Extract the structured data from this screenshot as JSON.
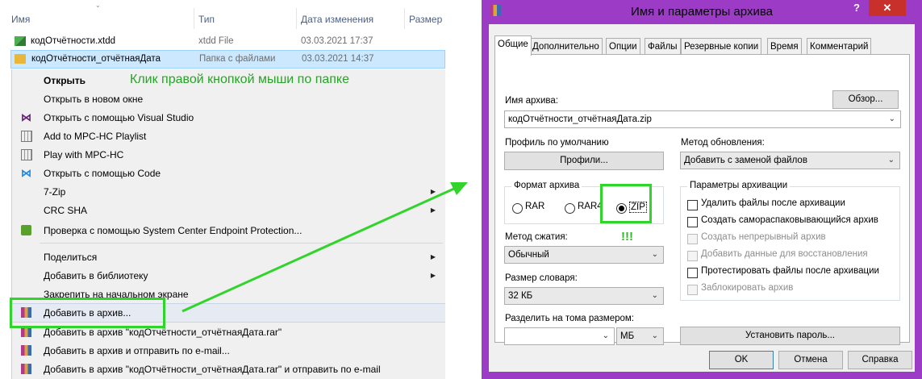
{
  "explorer": {
    "columns": {
      "name": "Имя",
      "type": "Тип",
      "date": "Дата изменения",
      "size": "Размер"
    },
    "files": [
      {
        "name": "кодОтчётности.xtdd",
        "type": "xtdd File",
        "date": "03.03.2021 17:37"
      },
      {
        "name": "кодОтчётности_отчётнаяДата",
        "type": "Папка с файлами",
        "date": "03.03.2021 14:37"
      }
    ]
  },
  "context_menu": {
    "items": [
      {
        "label": "Открыть",
        "icon": "none"
      },
      {
        "label": "Открыть в новом окне",
        "icon": "none"
      },
      {
        "label": "Открыть с помощью Visual Studio",
        "icon": "visual-studio-icon"
      },
      {
        "label": "Add to MPC-HC Playlist",
        "icon": "mpc-hc-icon"
      },
      {
        "label": "Play with MPC-HC",
        "icon": "mpc-hc-icon"
      },
      {
        "label": "Открыть с помощью Code",
        "icon": "vscode-icon"
      },
      {
        "label": "7-Zip",
        "icon": "none",
        "submenu": true
      },
      {
        "label": "CRC SHA",
        "icon": "none",
        "submenu": true
      },
      {
        "label": "Проверка с помощью System Center Endpoint Protection...",
        "icon": "endpoint-protection-icon"
      },
      {
        "label": "Поделиться",
        "icon": "none",
        "submenu": true
      },
      {
        "label": "Добавить в библиотеку",
        "icon": "none",
        "submenu": true
      },
      {
        "label": "Закрепить на начальном экране",
        "icon": "none"
      },
      {
        "label": "Добавить в архив...",
        "icon": "winrar-icon"
      },
      {
        "label": "Добавить в архив \"кодОтчётности_отчётнаяДата.rar\"",
        "icon": "winrar-icon"
      },
      {
        "label": "Добавить в архив и отправить по e-mail...",
        "icon": "winrar-icon"
      },
      {
        "label": "Добавить в архив \"кодОтчётности_отчётнаяДата.rar\" и отправить по e-mail",
        "icon": "winrar-icon"
      }
    ],
    "annotation": "Клик правой кнопкой мыши по папке"
  },
  "dialog": {
    "title": "Имя и параметры архива",
    "help_button": "?",
    "close_button": "✕",
    "tabs": [
      "Общие",
      "Дополнительно",
      "Опции",
      "Файлы",
      "Резервные копии",
      "Время",
      "Комментарий"
    ],
    "archive_name_label": "Имя архива:",
    "browse_button": "Обзор...",
    "archive_name_value": "кодОтчётности_отчётнаяДата.zip",
    "default_profile_label": "Профиль по умолчанию",
    "profiles_button": "Профили...",
    "update_method_label": "Метод обновления:",
    "update_method_value": "Добавить с заменой файлов",
    "format_group_label": "Формат архива",
    "format_options": [
      "RAR",
      "RAR4",
      "ZIP"
    ],
    "format_selected": "ZIP",
    "exclamation": "!!!",
    "compression_label": "Метод сжатия:",
    "compression_value": "Обычный",
    "dictionary_label": "Размер словаря:",
    "dictionary_value": "32 КБ",
    "split_label": "Разделить на тома размером:",
    "split_value": "",
    "split_unit": "МБ",
    "options_group_label": "Параметры архивации",
    "options": [
      {
        "label": "Удалить файлы после архивации",
        "enabled": true,
        "checked": false
      },
      {
        "label": "Создать самораспаковывающийся архив",
        "enabled": true,
        "checked": false
      },
      {
        "label": "Создать непрерывный архив",
        "enabled": false,
        "checked": false
      },
      {
        "label": "Добавить данные для восстановления",
        "enabled": false,
        "checked": false
      },
      {
        "label": "Протестировать файлы после архивации",
        "enabled": true,
        "checked": false
      },
      {
        "label": "Заблокировать архив",
        "enabled": false,
        "checked": false
      }
    ],
    "set_password_button": "Установить пароль...",
    "ok_button": "OK",
    "cancel_button": "Отмена",
    "help_text_button": "Справка"
  },
  "colors": {
    "annotation_green": "#31d42a",
    "dialog_frame": "#9c3cc6",
    "close_red": "#c7302b"
  }
}
